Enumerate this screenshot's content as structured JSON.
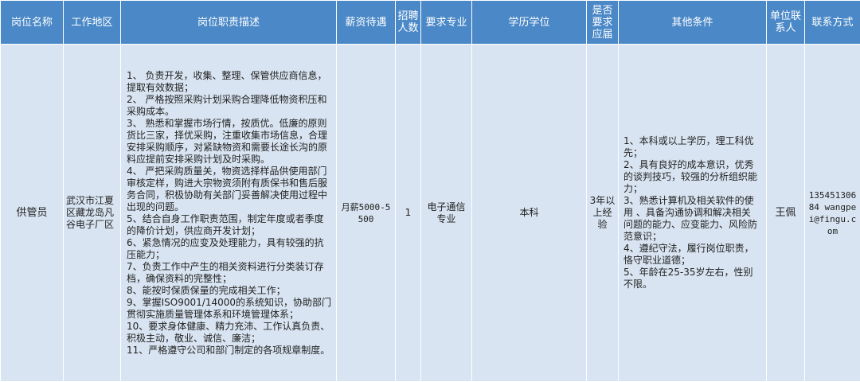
{
  "headers": {
    "position": "岗位名称",
    "location": "工作地区",
    "duties": "岗位职责描述",
    "salary": "薪资待遇",
    "headcount": "招聘\n人数",
    "major": "要求专业",
    "education": "学历学位",
    "fresh_grad": "是否\n要求\n应届",
    "other": "其他条件",
    "contact": "单位联\n系人",
    "contact_method": "联系方式"
  },
  "row": {
    "position": "供管员",
    "location": "武汉市江夏区藏龙岛凡谷电子厂区",
    "duties": [
      "1、 负责开发，收集、整理、保管供应商信息，提取有效数据；",
      "2、 严格按照采购计划采购合理降低物资积压和采购成本。",
      "3、 熟悉和掌握市场行情，按质优。低廉的原则货比三家，择优采购，注重收集市场信息，合理安排采购顺序，对紧缺物资和需要长途长沟的原料应提前安排采购计划及时采购。",
      "4、 严把采购质量关，物资选择样品供使用部门审核定样，购进大宗物资须附有质保书和售后服务合同，积极协助有关部门妥善解决使用过程中出现的问题。",
      "5、结合自身工作职责范围，制定年度或者季度的降价计划，供应商开发计划；",
      "6、紧急情况的应变及处理能力，具有较强的抗压能力；",
      "7、负责工作中产生的相关资料进行分类装订存档，确保资料的完整性；",
      "8、能按时保质保量的完成相关工作；",
      "9、掌握ISO9001/14000的系统知识，协助部门贯彻实施质量管理体系和环境管理体系；",
      "10、要求身体健康、精力充沛、工作认真负责、积极主动，敬业、诚信、廉洁；",
      "11、严格遵守公司和部门制定的各项规章制度。"
    ],
    "salary": "月薪5000-5500",
    "headcount": "1",
    "major": "电子通信专业",
    "education": "本科",
    "fresh_grad": "3年以上经验",
    "other": [
      "1、本科或以上学历，理工科优先；",
      "2、具有良好的成本意识，优秀的谈判技巧，较强的分析组织能力；",
      "3、熟悉计算机及相关软件的使用 、具备沟通协调和解决相关问题的能力、应变能力、风险防范意识；",
      "4、遵纪守法，履行岗位职责，恪守职业道德；",
      "5、年龄在25-35岁左右，性别不限。"
    ],
    "contact": "王佩",
    "contact_method": "13545130684 wangpei@fingu.com"
  }
}
